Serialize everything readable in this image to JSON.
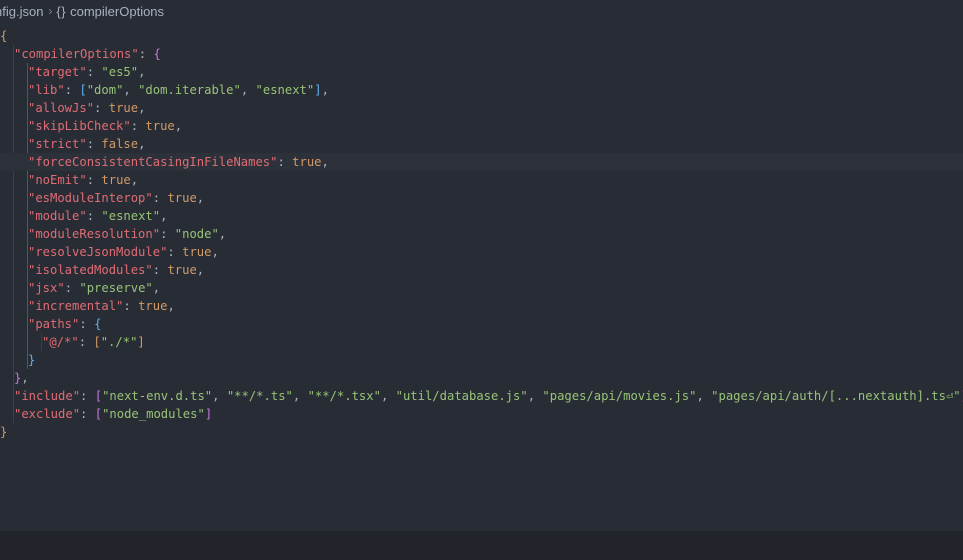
{
  "breadcrumb": {
    "file": "nfig.json",
    "separator": "›",
    "symbol_icon": "{}",
    "symbol": "compilerOptions"
  },
  "editor": {
    "active_line": 7,
    "lines": [
      {
        "indent": 0,
        "tokens": [
          {
            "t": "{",
            "c": "b1"
          }
        ]
      },
      {
        "indent": 1,
        "tokens": [
          {
            "t": "\"compilerOptions\"",
            "c": "key"
          },
          {
            "t": ": ",
            "c": "p"
          },
          {
            "t": "{",
            "c": "b2"
          }
        ]
      },
      {
        "indent": 2,
        "tokens": [
          {
            "t": "\"target\"",
            "c": "key"
          },
          {
            "t": ": ",
            "c": "p"
          },
          {
            "t": "\"es5\"",
            "c": "str"
          },
          {
            "t": ",",
            "c": "p"
          }
        ]
      },
      {
        "indent": 2,
        "tokens": [
          {
            "t": "\"lib\"",
            "c": "key"
          },
          {
            "t": ": ",
            "c": "p"
          },
          {
            "t": "[",
            "c": "b3"
          },
          {
            "t": "\"dom\"",
            "c": "str"
          },
          {
            "t": ", ",
            "c": "p"
          },
          {
            "t": "\"dom.iterable\"",
            "c": "str"
          },
          {
            "t": ", ",
            "c": "p"
          },
          {
            "t": "\"esnext\"",
            "c": "str"
          },
          {
            "t": "]",
            "c": "b3"
          },
          {
            "t": ",",
            "c": "p"
          }
        ]
      },
      {
        "indent": 2,
        "tokens": [
          {
            "t": "\"allowJs\"",
            "c": "key"
          },
          {
            "t": ": ",
            "c": "p"
          },
          {
            "t": "true",
            "c": "kw"
          },
          {
            "t": ",",
            "c": "p"
          }
        ]
      },
      {
        "indent": 2,
        "tokens": [
          {
            "t": "\"skipLibCheck\"",
            "c": "key"
          },
          {
            "t": ": ",
            "c": "p"
          },
          {
            "t": "true",
            "c": "kw"
          },
          {
            "t": ",",
            "c": "p"
          }
        ]
      },
      {
        "indent": 2,
        "tokens": [
          {
            "t": "\"strict\"",
            "c": "key"
          },
          {
            "t": ": ",
            "c": "p"
          },
          {
            "t": "false",
            "c": "kw"
          },
          {
            "t": ",",
            "c": "p"
          }
        ]
      },
      {
        "indent": 2,
        "tokens": [
          {
            "t": "\"forceConsistentCasingInFileNames\"",
            "c": "key"
          },
          {
            "t": ": ",
            "c": "p"
          },
          {
            "t": "true",
            "c": "kw"
          },
          {
            "t": ",",
            "c": "p"
          }
        ]
      },
      {
        "indent": 2,
        "tokens": [
          {
            "t": "\"noEmit\"",
            "c": "key"
          },
          {
            "t": ": ",
            "c": "p"
          },
          {
            "t": "true",
            "c": "kw"
          },
          {
            "t": ",",
            "c": "p"
          }
        ]
      },
      {
        "indent": 2,
        "tokens": [
          {
            "t": "\"esModuleInterop\"",
            "c": "key"
          },
          {
            "t": ": ",
            "c": "p"
          },
          {
            "t": "true",
            "c": "kw"
          },
          {
            "t": ",",
            "c": "p"
          }
        ]
      },
      {
        "indent": 2,
        "tokens": [
          {
            "t": "\"module\"",
            "c": "key"
          },
          {
            "t": ": ",
            "c": "p"
          },
          {
            "t": "\"esnext\"",
            "c": "str"
          },
          {
            "t": ",",
            "c": "p"
          }
        ]
      },
      {
        "indent": 2,
        "tokens": [
          {
            "t": "\"moduleResolution\"",
            "c": "key"
          },
          {
            "t": ": ",
            "c": "p"
          },
          {
            "t": "\"node\"",
            "c": "str"
          },
          {
            "t": ",",
            "c": "p"
          }
        ]
      },
      {
        "indent": 2,
        "tokens": [
          {
            "t": "\"resolveJsonModule\"",
            "c": "key"
          },
          {
            "t": ": ",
            "c": "p"
          },
          {
            "t": "true",
            "c": "kw"
          },
          {
            "t": ",",
            "c": "p"
          }
        ]
      },
      {
        "indent": 2,
        "tokens": [
          {
            "t": "\"isolatedModules\"",
            "c": "key"
          },
          {
            "t": ": ",
            "c": "p"
          },
          {
            "t": "true",
            "c": "kw"
          },
          {
            "t": ",",
            "c": "p"
          }
        ]
      },
      {
        "indent": 2,
        "tokens": [
          {
            "t": "\"jsx\"",
            "c": "key"
          },
          {
            "t": ": ",
            "c": "p"
          },
          {
            "t": "\"preserve\"",
            "c": "str"
          },
          {
            "t": ",",
            "c": "p"
          }
        ]
      },
      {
        "indent": 2,
        "tokens": [
          {
            "t": "\"incremental\"",
            "c": "key"
          },
          {
            "t": ": ",
            "c": "p"
          },
          {
            "t": "true",
            "c": "kw"
          },
          {
            "t": ",",
            "c": "p"
          }
        ]
      },
      {
        "indent": 2,
        "tokens": [
          {
            "t": "\"paths\"",
            "c": "key"
          },
          {
            "t": ": ",
            "c": "p"
          },
          {
            "t": "{",
            "c": "b3"
          }
        ]
      },
      {
        "indent": 3,
        "tokens": [
          {
            "t": "\"@/*\"",
            "c": "key"
          },
          {
            "t": ": ",
            "c": "p"
          },
          {
            "t": "[",
            "c": "b1"
          },
          {
            "t": "\"./*\"",
            "c": "str"
          },
          {
            "t": "]",
            "c": "b1"
          }
        ]
      },
      {
        "indent": 2,
        "tokens": [
          {
            "t": "}",
            "c": "b3"
          }
        ]
      },
      {
        "indent": 1,
        "tokens": [
          {
            "t": "}",
            "c": "b2"
          },
          {
            "t": ",",
            "c": "p"
          }
        ]
      },
      {
        "indent": 1,
        "tokens": [
          {
            "t": "\"include\"",
            "c": "key"
          },
          {
            "t": ": ",
            "c": "p"
          },
          {
            "t": "[",
            "c": "b2"
          },
          {
            "t": "\"next-env.d.ts\"",
            "c": "str"
          },
          {
            "t": ", ",
            "c": "p"
          },
          {
            "t": "\"**/*.ts\"",
            "c": "str"
          },
          {
            "t": ", ",
            "c": "p"
          },
          {
            "t": "\"**/*.tsx\"",
            "c": "str"
          },
          {
            "t": ", ",
            "c": "p"
          },
          {
            "t": "\"util/database.js\"",
            "c": "str"
          },
          {
            "t": ", ",
            "c": "p"
          },
          {
            "t": "\"pages/api/movies.js\"",
            "c": "str"
          },
          {
            "t": ", ",
            "c": "p"
          },
          {
            "t": "\"pages/api/auth/[...nextauth].ts⏎\"",
            "c": "str"
          },
          {
            "t": "]",
            "c": "b2"
          },
          {
            "t": ",",
            "c": "p"
          }
        ]
      },
      {
        "indent": 1,
        "tokens": [
          {
            "t": "\"exclude\"",
            "c": "key"
          },
          {
            "t": ": ",
            "c": "p"
          },
          {
            "t": "[",
            "c": "b2"
          },
          {
            "t": "\"node_modules\"",
            "c": "str"
          },
          {
            "t": "]",
            "c": "b2"
          }
        ]
      },
      {
        "indent": 0,
        "tokens": [
          {
            "t": "}",
            "c": "b1"
          }
        ]
      }
    ]
  }
}
